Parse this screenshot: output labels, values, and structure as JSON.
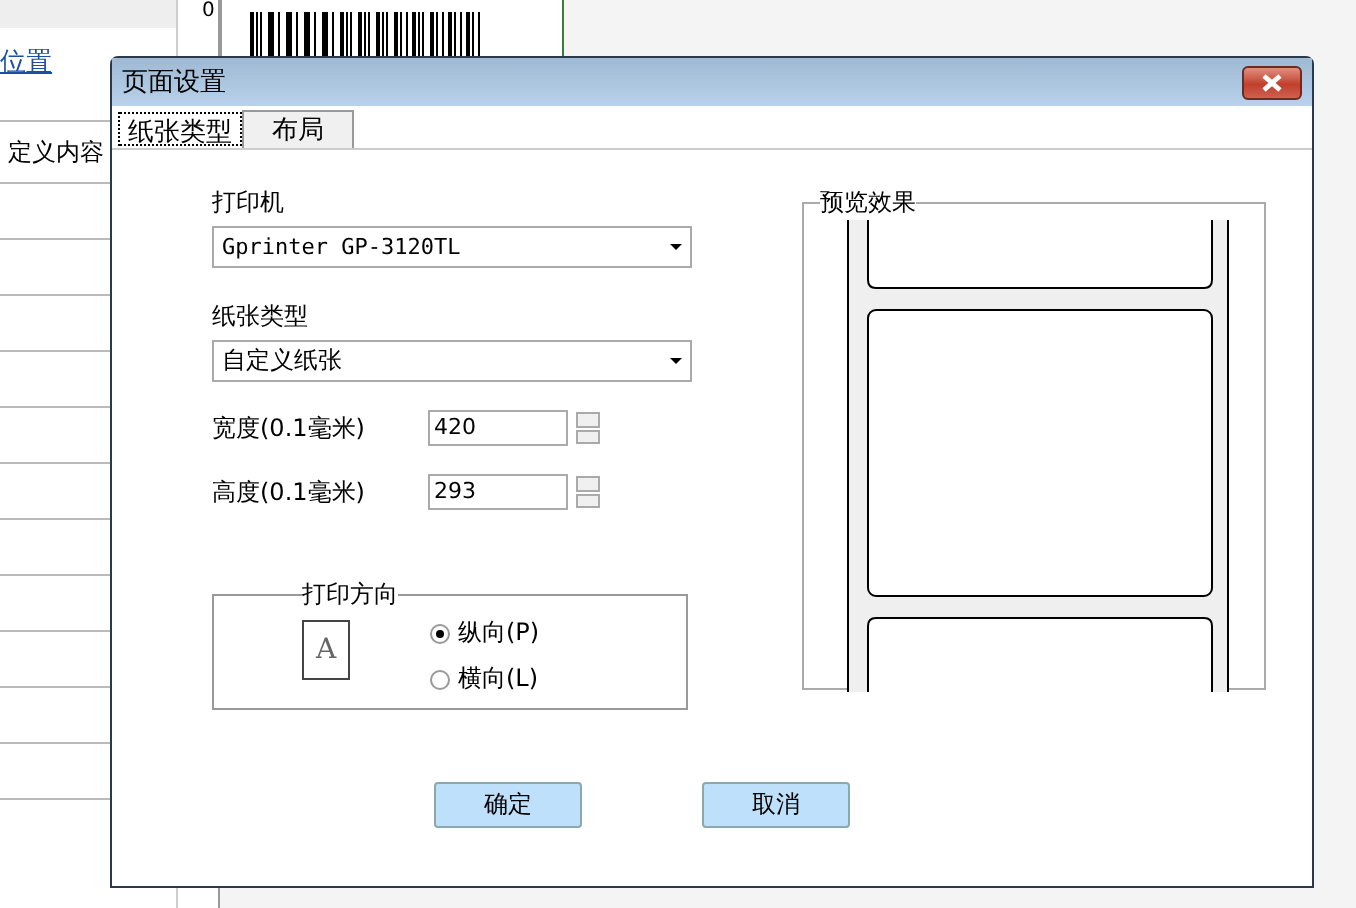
{
  "background": {
    "link": "位置",
    "label": "定义内容",
    "ruler_mark": "0"
  },
  "dialog": {
    "title": "页面设置",
    "tabs": [
      {
        "label": "纸张类型",
        "selected": true
      },
      {
        "label": "布局",
        "selected": false
      }
    ],
    "printer": {
      "label": "打印机",
      "value": "Gprinter GP-3120TL"
    },
    "paper_type": {
      "label": "纸张类型",
      "value": "自定义纸张"
    },
    "spinners": [
      {
        "label": "宽度(0.1毫米)",
        "value": "420"
      },
      {
        "label": "高度(0.1毫米)",
        "value": "293"
      }
    ],
    "orientation": {
      "title": "打印方向",
      "icon_glyph": "A",
      "options": [
        {
          "label": "纵向(P)",
          "selected": true
        },
        {
          "label": "横向(L)",
          "selected": false
        }
      ]
    },
    "preview": {
      "title": "预览效果"
    },
    "buttons": [
      "确定",
      "取消"
    ]
  }
}
